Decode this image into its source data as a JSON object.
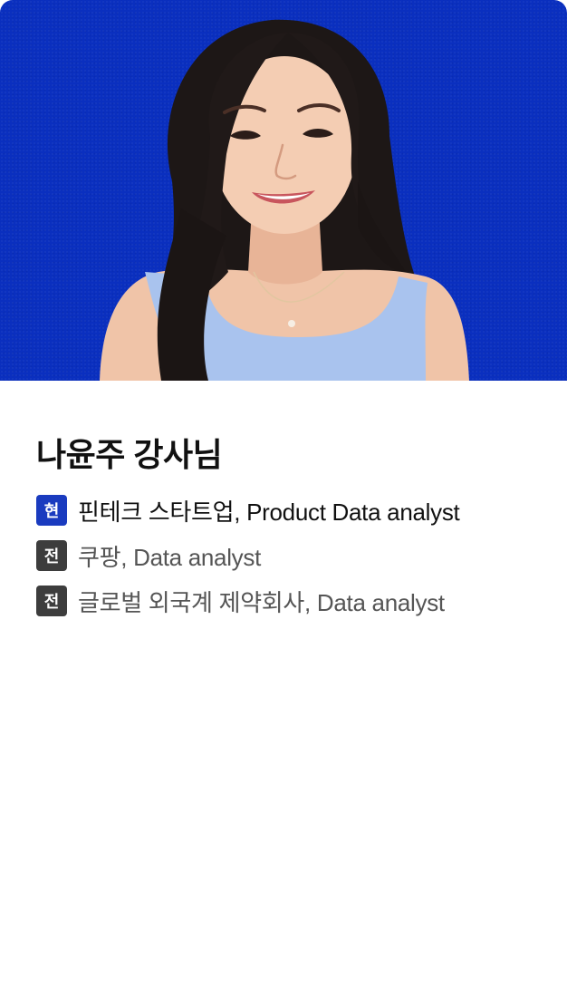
{
  "hero": {
    "background_color": "#0a2fbf"
  },
  "instructor": {
    "name": "나윤주 강사님"
  },
  "careers": [
    {
      "badge": "현",
      "text": "핀테크 스타트업, Product Data analyst",
      "status": "current",
      "badge_color": "#1a3bbf"
    },
    {
      "badge": "전",
      "text": "쿠팡, Data analyst",
      "status": "former",
      "badge_color": "#3d3d3d"
    },
    {
      "badge": "전",
      "text": "글로벌 외국계 제약회사, Data analyst",
      "status": "former",
      "badge_color": "#3d3d3d"
    }
  ]
}
